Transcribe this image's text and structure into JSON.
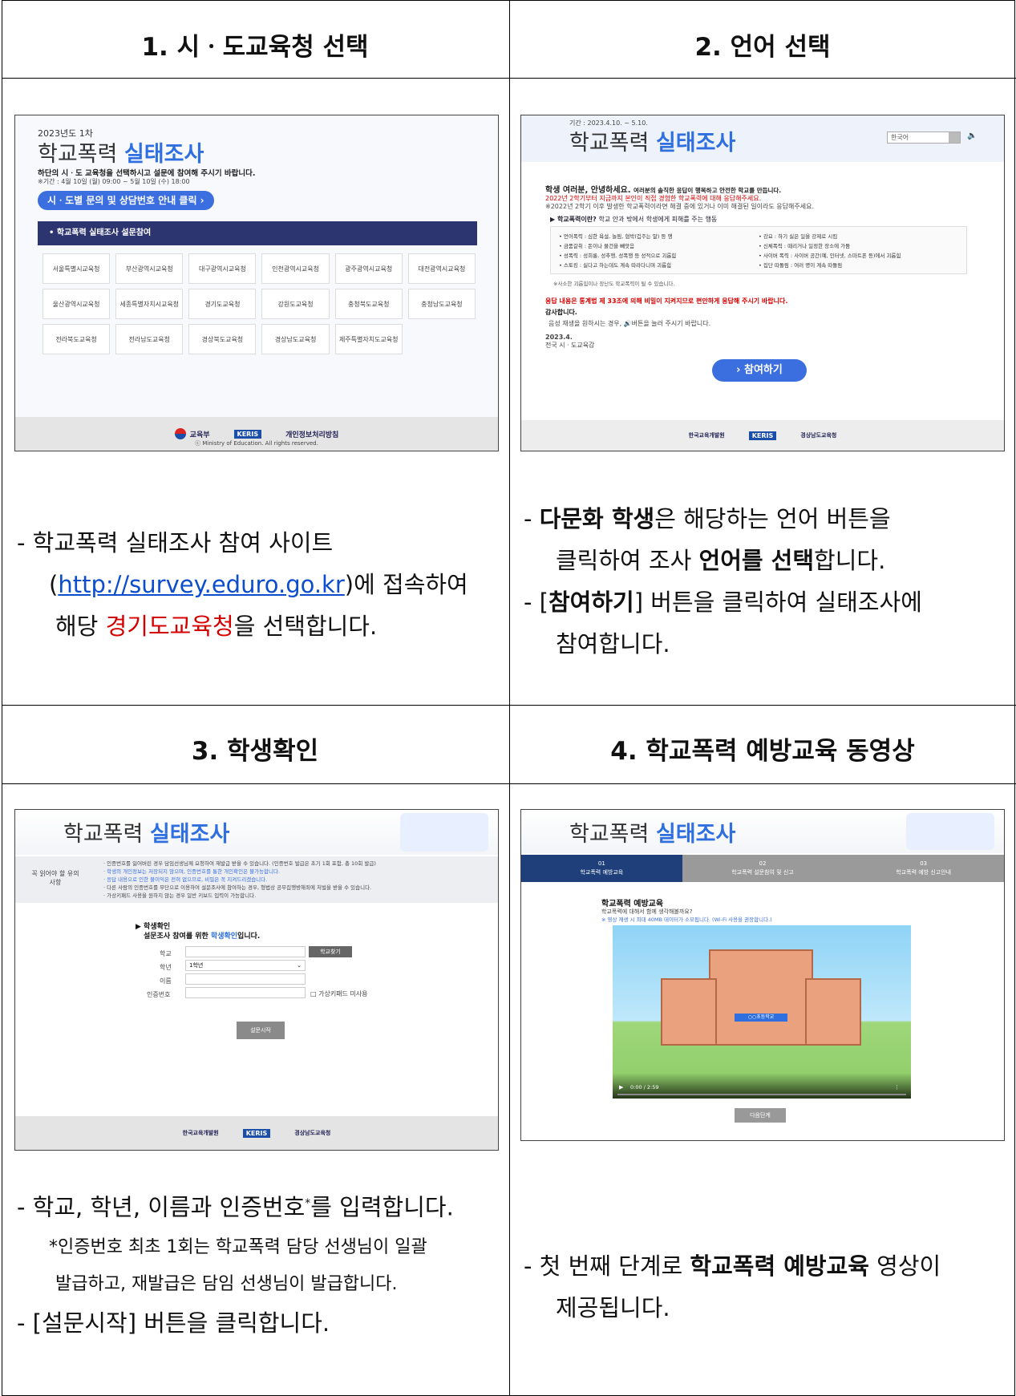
{
  "cells": [
    {
      "title": "1. 시ㆍ도교육청 선택"
    },
    {
      "title": "2. 언어 선택"
    },
    {
      "title": "3. 학생확인"
    },
    {
      "title": "4. 학교폭력 예방교육 동영상"
    }
  ],
  "shot1": {
    "year": "2023년도 1차",
    "title_a": "학교폭력",
    "title_b": "실태조사",
    "subtitle": "하단의 시ㆍ도 교육청을 선택하시고 설문에 참여해 주시기 바랍니다.",
    "period": "※기간 : 4월 10일 (월) 09:00 ~ 5월 10일 (수) 18:00",
    "contact_button": "시ㆍ도별 문의 및 상담번호 안내 클릭 ›",
    "section_header": "• 학교폭력 실태조사 설문참여",
    "offices": [
      "서울특별시교육청",
      "부산광역시교육청",
      "대구광역시교육청",
      "인천광역시교육청",
      "광주광역시교육청",
      "대전광역시교육청",
      "울산광역시교육청",
      "세종특별자치시교육청",
      "경기도교육청",
      "강원도교육청",
      "충청북도교육청",
      "충청남도교육청",
      "전라북도교육청",
      "전라남도교육청",
      "경상북도교육청",
      "경상남도교육청",
      "제주특별자치도교육청"
    ],
    "footer_moe": "교육부",
    "footer_keris": "KERIS",
    "footer_privacy": "개인정보처리방침",
    "footer_copy": "ⓒ Ministry of Education. All rights reserved."
  },
  "shot2": {
    "period": "기간 : 2023.4.10. ~ 5.10.",
    "title_a": "학교폭력",
    "title_b": "실태조사",
    "lang": "한국어",
    "greeting": "학생 여러분, 안녕하세요.",
    "greeting_tail": "여러분의 솔직한 응답이 행복하고 안전한 학교를 만듭니다.",
    "line1": "2022년 2학기부터 지금까지 본인이 직접 경험한 학교폭력에 대해 응답해주세요.",
    "line2": "※2022년 2학기 이후 발생한 학교폭력이라면 해결 중에 있거나 이미 해결된 일이라도 응답해주세요.",
    "what": "▶ 학교폭력이란?",
    "what_tail": "학교 안과 밖에서 학생에게 피해를 주는 행동",
    "types": [
      "• 언어폭력 : 심한 욕설, 놀림, 협박(겁주는 말) 등 행",
      "• 금품갈취 : 돈이나 물건을 빼앗음",
      "• 성폭력 : 성희롱, 성추행, 성폭행 등 성적으로 괴롭힘",
      "• 스토킹 : 싫다고 하는데도 계속 따라다니며 괴롭힘",
      "• 강요 : 하기 싫은 일을 강제로 시킴",
      "• 신체폭력 : 때리거나 일정한 장소에 가둠",
      "• 사이버 폭력 : 사이버 공간(예, 인터넷, 스마트폰 등)에서 괴롭힘",
      "• 집단 따돌림 : 여러 명이 계속 따돌림"
    ],
    "minor": "※사소한 괴롭힘이나 장난도 학교폭력이 될 수 있습니다.",
    "notice": "응답 내용은 통계법 제 33조에 의해 비밀이 지켜지므로 편안하게 응답해 주시기 바랍니다.",
    "thanks": "감사합니다.",
    "audio": "음성 재생을 원하시는 경우, 🔊버튼을 눌러 주시기 바랍니다.",
    "date": "2023.4.",
    "sign": "전국 시ㆍ도교육감",
    "join": "› 참여하기",
    "footer1": "한국교육개발원",
    "footer2": "KERIS",
    "footer3": "경상남도교육청"
  },
  "shot3": {
    "title_a": "학교폭력",
    "title_b": "실태조사",
    "must_read": "꼭 읽어야 할 유의사항",
    "notes": [
      "· 인증번호를 잃어버린 경우 담임선생님께 요청하여 재발급 받을 수 있습니다. (인증번호 발급은 초기 1회 포함, 총 10회 발급)",
      "· 학생의 개인정보는 저장되지 않으며, 인증번호를 통한 개인확인은 불가능합니다.",
      "· 응답 내용으로 인한 불이익은 전혀 없으므로, 비밀은 꼭 지켜드리겠습니다.",
      "· 다른 사람의 인증번호를 무단으로 이용하여 설문조사에 참여하는 경우, 형법상 공무집행방해죄에 처벌을 받을 수 있습니다.",
      "· 가상키패드 사용을 원하지 않는 경우 일반 키보드 입력이 가능합니다."
    ],
    "heading": "▶ 학생확인",
    "sub_a": "설문조사 참여를 위한 ",
    "sub_b": "학생확인",
    "sub_c": "입니다.",
    "label_school": "학교",
    "label_grade": "학년",
    "grade_value": "1학년",
    "label_name": "이름",
    "label_code": "인증번호",
    "find_school": "학교찾기",
    "keypad": "□ 가상키패드 미사용",
    "start": "설문시작",
    "footer1": "한국교육개발원",
    "footer2": "KERIS",
    "footer3": "경상남도교육청"
  },
  "shot4": {
    "title_a": "학교폭력",
    "title_b": "실태조사",
    "tabs": [
      {
        "num": "01",
        "label": "학교폭력 예방교육"
      },
      {
        "num": "02",
        "label": "학교폭력 설문참여 및 신고"
      },
      {
        "num": "03",
        "label": "학교폭력 예방 신고안내"
      }
    ],
    "heading": "학교폭력 예방교육",
    "desc1": "학교폭력에 대해서 함께 생각해볼까요?",
    "desc2": "※ 영상 재생 시 최대 40MB 데이터가 소모됩니다. (Wi-Fi 사용을 권장합니다.)",
    "school_sign": "○○초등학교",
    "time": "0:00 / 2:59",
    "next": "다음단계"
  },
  "desc1": {
    "a": "- 학교폭력 실태조사 참여 사이트",
    "link": "http://survey.eduro.go.kr",
    "b": "에 접속하여",
    "c": "해당 ",
    "red": "경기도교육청",
    "d": "을 선택합니다."
  },
  "desc2": {
    "a_bold": "다문화 학생",
    "a": "은 해당하는 언어 버튼을",
    "b": "클릭하여 조사 ",
    "b_bold": "언어를 선택",
    "b2": "합니다.",
    "c_bold": "참여하기",
    "c": " 버튼을 클릭하여 실태조사에",
    "d": "참여합니다."
  },
  "desc3": {
    "a": "- 학교, 학년, 이름과 인증번호",
    "a_star": "*",
    "a2": "를 입력합니다.",
    "b": "*인증번호 최초 1회는 학교폭력 담당 선생님이 일괄",
    "c": "발급하고, 재발급은 담임 선생님이 발급합니다.",
    "d": "- [설문시작] 버튼을 클릭합니다."
  },
  "desc4": {
    "a": "- 첫 번째 단계로 ",
    "a_bold": "학교폭력 예방교육",
    "a2": " 영상이",
    "b": "제공됩니다."
  }
}
